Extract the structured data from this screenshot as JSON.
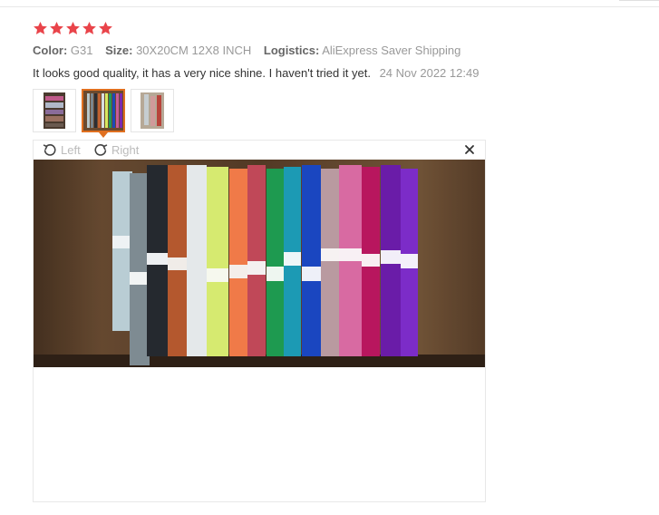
{
  "review": {
    "rating": 5,
    "star_color": "#e9444a",
    "color_label": "Color:",
    "color_value": "G31",
    "size_label": "Size:",
    "size_value": "30X20CM 12X8 INCH",
    "logistics_label": "Logistics:",
    "logistics_value": "AliExpress Saver Shipping",
    "text": "It looks good quality, it has a very nice shine. I haven't tried it yet.",
    "date": "24 Nov 2022 12:49"
  },
  "thumbnails": [
    {
      "icon": "photo-thumbnail-1",
      "active": false
    },
    {
      "icon": "photo-thumbnail-2",
      "active": true
    },
    {
      "icon": "photo-thumbnail-3",
      "active": false
    }
  ],
  "viewer": {
    "rotate_left_label": "Left",
    "rotate_right_label": "Right",
    "rotate_left_icon": "rotate-left-icon",
    "rotate_right_icon": "rotate-right-icon",
    "close_icon": "close-icon",
    "accent_color": "#e07020"
  }
}
